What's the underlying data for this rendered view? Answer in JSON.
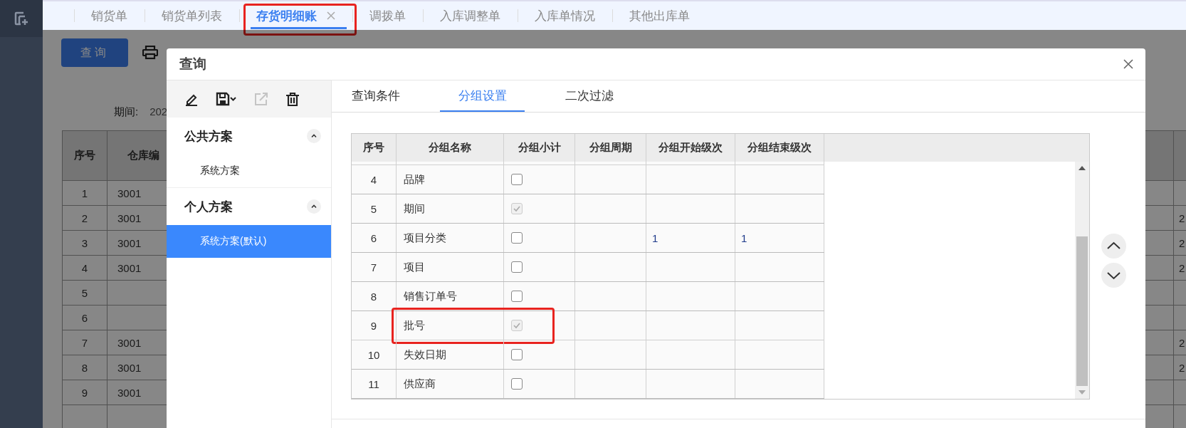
{
  "tabs": [
    {
      "label": "销货单",
      "selected": false,
      "closable": false,
      "highlighted": false
    },
    {
      "label": "销货单列表",
      "selected": false,
      "closable": false,
      "highlighted": false
    },
    {
      "label": "存货明细账",
      "selected": true,
      "closable": true,
      "highlighted": true
    },
    {
      "label": "调拨单",
      "selected": false,
      "closable": false,
      "highlighted": false
    },
    {
      "label": "入库调整单",
      "selected": false,
      "closable": false,
      "highlighted": false
    },
    {
      "label": "入库单情况",
      "selected": false,
      "closable": false,
      "highlighted": false
    },
    {
      "label": "其他出库单",
      "selected": false,
      "closable": false,
      "highlighted": false
    }
  ],
  "page": {
    "query_button": "查询",
    "period_label": "期间:",
    "period_value": "202",
    "table": {
      "columns": [
        "序号",
        "仓库编"
      ],
      "rows": [
        {
          "no": "1",
          "warehouse": "3001"
        },
        {
          "no": "2",
          "warehouse": "3001",
          "column_3": "2"
        },
        {
          "no": "3",
          "warehouse": "3001",
          "column_3": "2"
        },
        {
          "no": "4",
          "warehouse": "3001",
          "column_3": "2"
        },
        {
          "no": "5"
        },
        {
          "no": "6"
        },
        {
          "no": "7",
          "warehouse": "3001",
          "column_3": "2"
        },
        {
          "no": "8",
          "warehouse": "3001",
          "column_3": "2"
        },
        {
          "no": "9",
          "warehouse": "3001"
        }
      ]
    }
  },
  "dialog": {
    "title": "查询",
    "toolbar": [
      {
        "kind": "edit",
        "disabled": false
      },
      {
        "kind": "save",
        "disabled": false
      },
      {
        "kind": "export",
        "disabled": true
      },
      {
        "kind": "delete",
        "disabled": false
      }
    ],
    "schemes": [
      {
        "title": "公共方案",
        "expanded": true,
        "items": [
          {
            "label": "系统方案",
            "selected": false
          }
        ]
      },
      {
        "title": "个人方案",
        "expanded": true,
        "items": [
          {
            "label": "系统方案(默认)",
            "selected": true
          }
        ]
      }
    ],
    "tabs": [
      {
        "label": "查询条件",
        "selected": false
      },
      {
        "label": "分组设置",
        "selected": true
      },
      {
        "label": "二次过滤",
        "selected": false
      }
    ],
    "group_table": {
      "columns": [
        "序号",
        "分组名称",
        "分组小计",
        "分组周期",
        "分组开始级次",
        "分组结束级次"
      ],
      "rows": [
        {
          "no": "4",
          "name": "品牌",
          "checked": false,
          "disabled": false,
          "highlighted": false
        },
        {
          "no": "5",
          "name": "期间",
          "checked": true,
          "disabled": true,
          "highlighted": false
        },
        {
          "no": "6",
          "name": "项目分类",
          "checked": false,
          "disabled": false,
          "start_level": "1",
          "end_level": "1",
          "highlighted": false
        },
        {
          "no": "7",
          "name": "项目",
          "checked": false,
          "disabled": false,
          "highlighted": false
        },
        {
          "no": "8",
          "name": "销售订单号",
          "checked": false,
          "disabled": false,
          "highlighted": false
        },
        {
          "no": "9",
          "name": "批号",
          "checked": true,
          "disabled": true,
          "highlighted": true
        },
        {
          "no": "10",
          "name": "失效日期",
          "checked": false,
          "disabled": false,
          "highlighted": false
        },
        {
          "no": "11",
          "name": "供应商",
          "checked": false,
          "disabled": false,
          "highlighted": false
        }
      ]
    }
  }
}
